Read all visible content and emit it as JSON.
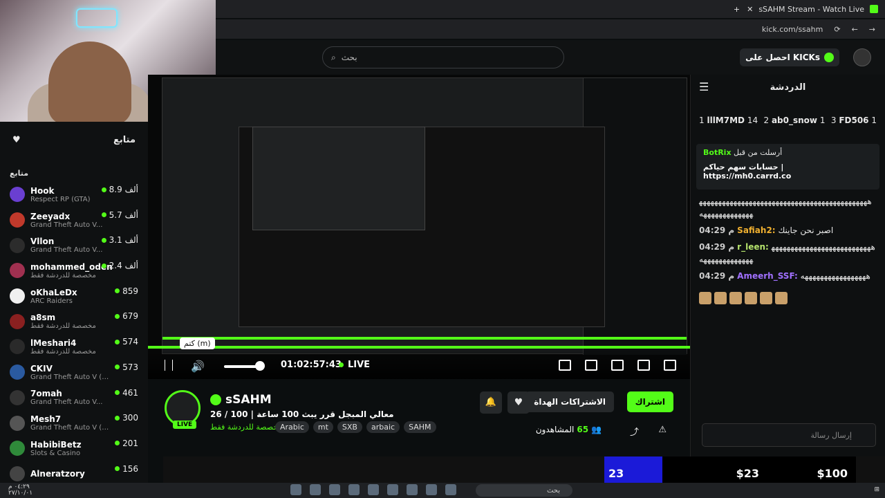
{
  "browser": {
    "tab_title": "sSAHM Stream - Watch Live",
    "address": "kick.com/ssahm",
    "new_tab_symbol": "+",
    "close_symbol": "✕"
  },
  "header": {
    "search_placeholder": "بحث",
    "kicks_label": "احصل على KICKs"
  },
  "sidebar": {
    "following_title": "متابع",
    "following_sub": "متابع",
    "items": [
      {
        "name": "Hook",
        "game": "Respect RP (GTA)",
        "viewers": "8.9 ألف",
        "color": "#6a3fd1"
      },
      {
        "name": "Zeeyadx",
        "game": "Grand Theft Auto V...",
        "viewers": "5.7 ألف",
        "color": "#c0392b"
      },
      {
        "name": "Vllon",
        "game": "Grand Theft Auto V...",
        "viewers": "3.1 ألف",
        "color": "#2c2c2c"
      },
      {
        "name": "mohammed_oden",
        "game": "مخصصة للدردشة فقط",
        "viewers": "2.4 ألف",
        "color": "#a03050"
      },
      {
        "name": "oKhaLeDx",
        "game": "ARC Raiders",
        "viewers": "859",
        "color": "#f0f0f0"
      },
      {
        "name": "a8sm",
        "game": "مخصصة للدردشة فقط",
        "viewers": "679",
        "color": "#8a2020"
      },
      {
        "name": "lMeshari4",
        "game": "مخصصة للدردشة فقط",
        "viewers": "574",
        "color": "#2a2a2a"
      },
      {
        "name": "CKIV",
        "game": "Grand Theft Auto V (G...",
        "viewers": "573",
        "color": "#2a5aa0"
      },
      {
        "name": "7omah",
        "game": "Grand Theft Auto V...",
        "viewers": "461",
        "color": "#333333"
      },
      {
        "name": "Mesh7",
        "game": "Grand Theft Auto V (G...",
        "viewers": "300",
        "color": "#555555"
      },
      {
        "name": "HabibiBetz",
        "game": "Slots & Casino",
        "viewers": "201",
        "color": "#2f8a3a"
      },
      {
        "name": "Alneratzory",
        "game": "",
        "viewers": "156",
        "color": "#444444"
      }
    ]
  },
  "player": {
    "tooltip": "كتم (m)",
    "time": "01:02:57:43",
    "live": "LIVE",
    "volume_level": 0.82,
    "progress": 1.0
  },
  "channel": {
    "name": "sSAHM",
    "live_badge": "LIVE",
    "title": "26 / 100 | معالي المبجل قرر يبث 100 ساعة",
    "category": "مخصصة للدردشة فقط",
    "tags": [
      "Arabic",
      "mt",
      "SXB",
      "arbaic",
      "SAHM"
    ],
    "follow_label": "اشتراك",
    "subs_label": "الاشتراكات الهداة",
    "viewers_label": "المشاهدون",
    "viewers_count": "65"
  },
  "chat": {
    "title": "الدردشة",
    "leaderboard": [
      {
        "rank": "1",
        "name": "lllM7MD",
        "count": "14"
      },
      {
        "rank": "2",
        "name": "ab0_snow",
        "count": "1"
      },
      {
        "rank": "3",
        "name": "FD506",
        "count": "1"
      }
    ],
    "pinned_user": "BotRix",
    "pinned_by": "أرسلت من قبل",
    "pinned_text": "حسابات سهم حياكم | https://mh0.carrd.co",
    "messages": [
      {
        "time": "",
        "user": "",
        "text": "ههههههههههههههههههههههههههههههههههههههههههههههههههههههههههه",
        "cls": "u1"
      },
      {
        "time": "04:29 م",
        "user": "Safiah2:",
        "text": "اصبر نحن جاينك",
        "cls": "u1"
      },
      {
        "time": "04:29 م",
        "user": "r_leen:",
        "text": "ههههههههههههههههههههههههههههههههههههههههه",
        "cls": "u2"
      },
      {
        "time": "04:29 م",
        "user": "Ameerh_SSF:",
        "text": "هههههههههههههههههه",
        "cls": "u3"
      }
    ],
    "input_placeholder": "إرسال رسالة"
  },
  "overlay": {
    "blue_value": "23",
    "amount1": "$23",
    "amount2": "$100"
  },
  "taskbar": {
    "search": "بحث",
    "clock": "٠٤:٢٩ م",
    "date": "٢٧/١٠/٠١"
  }
}
